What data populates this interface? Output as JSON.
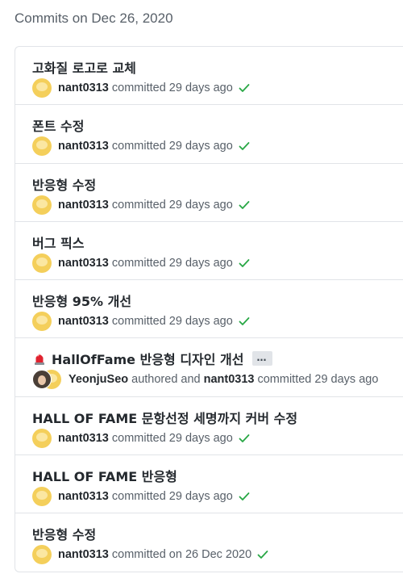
{
  "header": "Commits on Dec 26, 2020",
  "commits": [
    {
      "title": "고화질 로고로 교체",
      "user": "nant0313",
      "text": "committed 29 days ago"
    },
    {
      "title": "폰트 수정",
      "user": "nant0313",
      "text": "committed 29 days ago"
    },
    {
      "title": "반응형 수정",
      "user": "nant0313",
      "text": "committed 29 days ago"
    },
    {
      "title": "버그 픽스",
      "user": "nant0313",
      "text": "committed 29 days ago"
    },
    {
      "title": "반응형 95% 개선",
      "user": "nant0313",
      "text": "committed 29 days ago"
    },
    {
      "title": "HallOfFame 반응형 디자인 개선",
      "emoji": "alarm-light-icon",
      "ellipsis": "…",
      "author": "YeonjuSeo",
      "authored_text": "authored and",
      "user": "nant0313",
      "text": "committed 29 days ago"
    },
    {
      "title": "HALL OF FAME 문항선정 세명까지 커버 수정",
      "user": "nant0313",
      "text": "committed 29 days ago"
    },
    {
      "title": "HALL OF FAME 반응형",
      "user": "nant0313",
      "text": "committed 29 days ago"
    },
    {
      "title": "반응형 수정",
      "user": "nant0313",
      "text": "committed on 26 Dec 2020"
    }
  ],
  "colors": {
    "check": "#28a745",
    "avatar": "#f4cf5b",
    "muted": "#586069",
    "border": "#e1e4e8"
  }
}
